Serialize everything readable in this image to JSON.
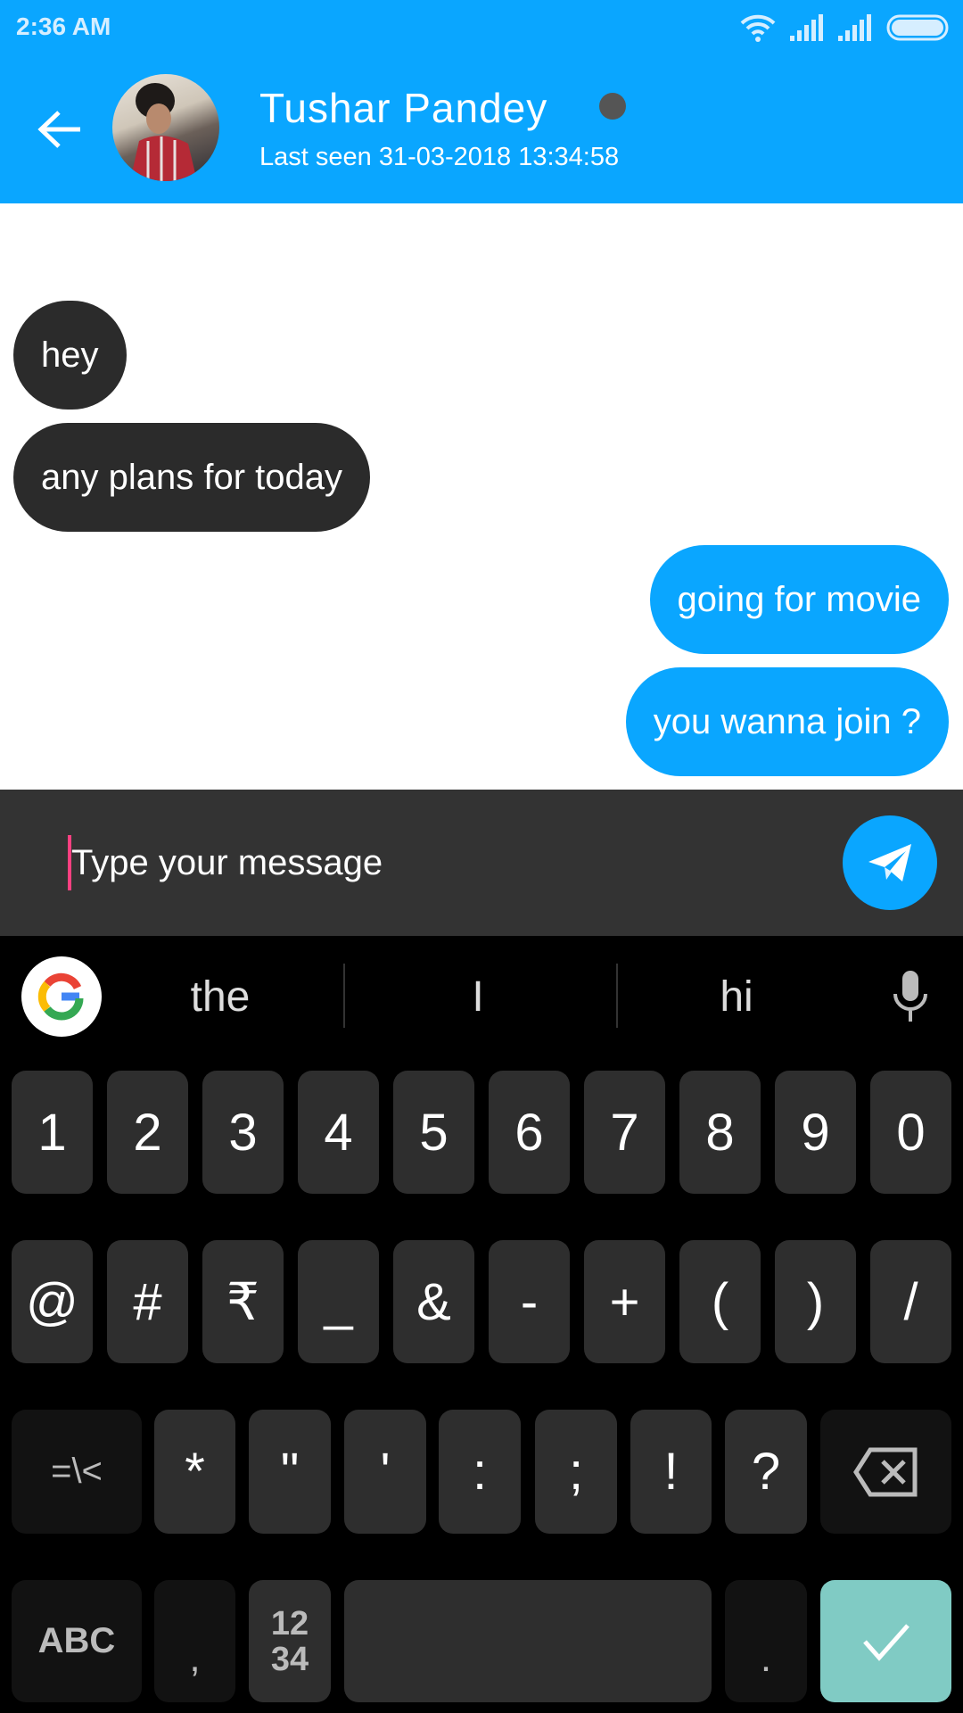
{
  "status_bar": {
    "time": "2:36 AM",
    "icons": [
      "wifi-icon",
      "signal-icon",
      "signal-icon",
      "battery-icon"
    ]
  },
  "header": {
    "contact_name": "Tushar Pandey",
    "last_seen": "Last seen 31-03-2018 13:34:58",
    "presence_color": "#555555",
    "accent": "#0aa6ff"
  },
  "messages": [
    {
      "text": "hey",
      "direction": "incoming"
    },
    {
      "text": "any plans for today",
      "direction": "incoming"
    },
    {
      "text": "going for movie",
      "direction": "outgoing"
    },
    {
      "text": "you wanna join ?",
      "direction": "outgoing"
    }
  ],
  "composer": {
    "placeholder": "Type your message",
    "value": ""
  },
  "keyboard": {
    "suggestions": [
      "the",
      "I",
      "hi"
    ],
    "rows": [
      [
        "1",
        "2",
        "3",
        "4",
        "5",
        "6",
        "7",
        "8",
        "9",
        "0"
      ],
      [
        "@",
        "#",
        "₹",
        "_",
        "&",
        "-",
        "+",
        "(",
        ")",
        "/"
      ],
      [
        "=\\<",
        "*",
        "\"",
        "'",
        ":",
        ";",
        "!",
        "?",
        "⌫"
      ],
      [
        "ABC",
        ",",
        "12\n34",
        " ",
        ".",
        "✓"
      ]
    ],
    "enter_color": "#80cbc4"
  }
}
